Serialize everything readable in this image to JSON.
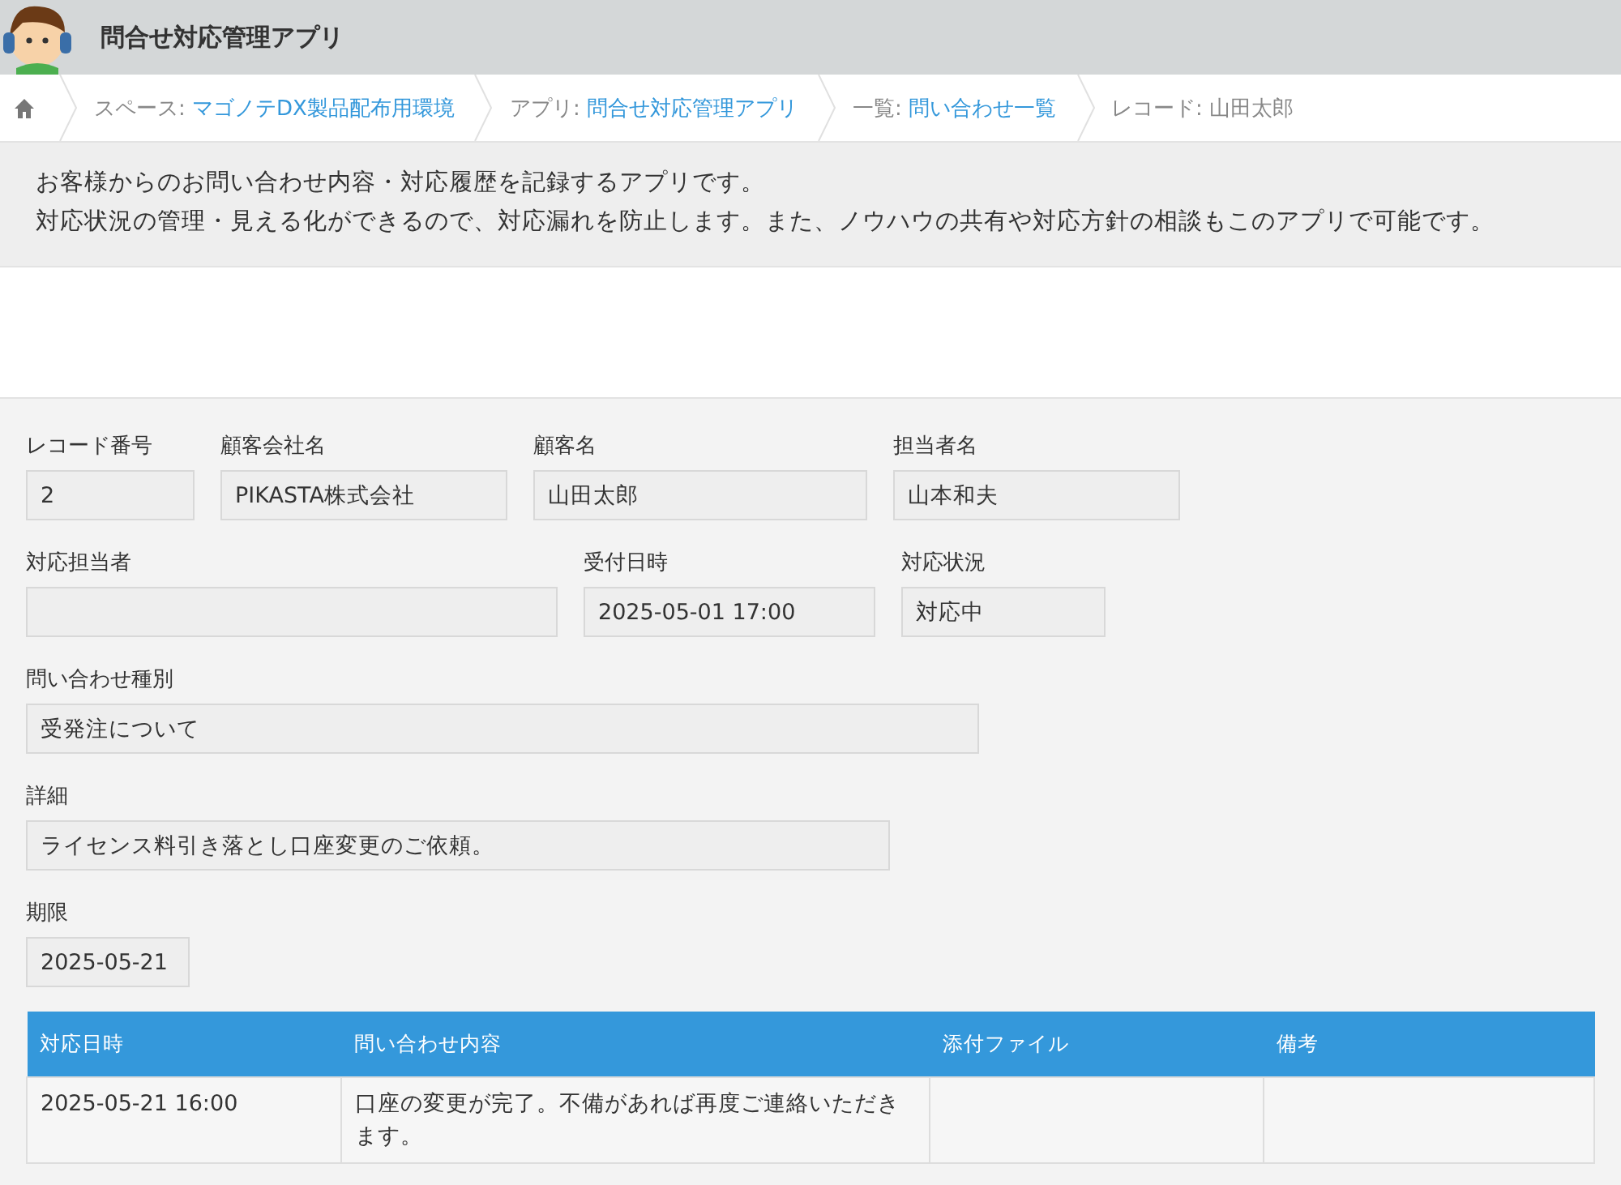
{
  "header": {
    "title": "問合せ対応管理アプリ"
  },
  "breadcrumb": [
    {
      "kind": "link",
      "prefix": "スペース:",
      "text": "マゴノテDX製品配布用環境"
    },
    {
      "kind": "link",
      "prefix": "アプリ:",
      "text": "問合せ対応管理アプリ"
    },
    {
      "kind": "link",
      "prefix": "一覧:",
      "text": "問い合わせ一覧"
    },
    {
      "kind": "plain",
      "prefix": "レコード:",
      "text": "山田太郎"
    }
  ],
  "description": [
    "お客様からのお問い合わせ内容・対応履歴を記録するアプリです。",
    "対応状況の管理・見える化ができるので、対応漏れを防止します。また、ノウハウの共有や対応方針の相談もこのアプリで可能です。"
  ],
  "form_rows": [
    [
      {
        "label": "レコード番号",
        "value": "2"
      },
      {
        "label": "顧客会社名",
        "value": "PIKASTA株式会社"
      },
      {
        "label": "顧客名",
        "value": "山田太郎"
      },
      {
        "label": "担当者名",
        "value": "山本和夫"
      }
    ],
    [
      {
        "label": "対応担当者"
      },
      {
        "label": "受付日時",
        "value": "2025-05-01 17:00"
      },
      {
        "label": "対応状況",
        "value": "対応中"
      }
    ],
    [
      {
        "label": "問い合わせ種別",
        "value": "受発注について"
      }
    ],
    [
      {
        "label": "詳細",
        "value": "ライセンス料引き落とし口座変更のご依頼。"
      }
    ],
    [
      {
        "label": "期限",
        "value": "2025-05-21"
      }
    ]
  ],
  "table": {
    "columns": [
      "対応日時",
      "問い合わせ内容",
      "添付ファイル",
      "備考"
    ],
    "rows": [
      [
        "2025-05-21 16:00",
        "口座の変更が完了。不備があれば再度ご連絡いただきます。"
      ]
    ]
  }
}
